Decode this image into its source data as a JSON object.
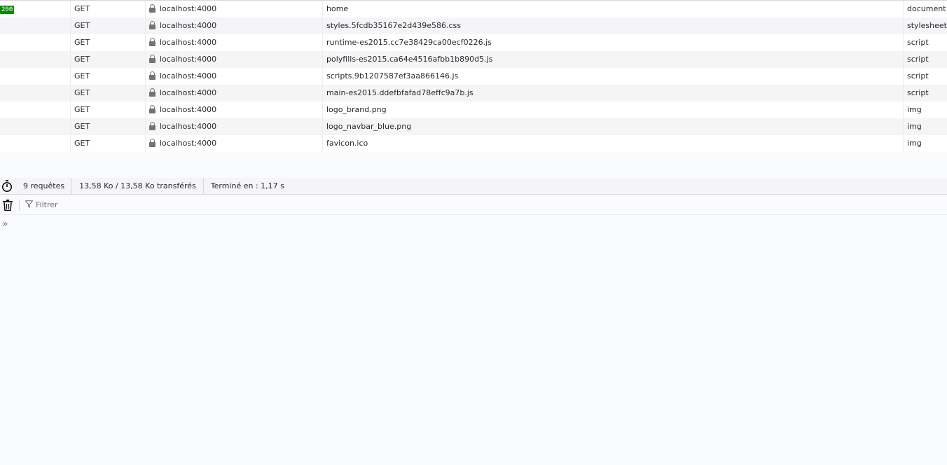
{
  "requests": [
    {
      "status": "200",
      "method": "GET",
      "domain": "localhost:4000",
      "file": "home",
      "type": "document"
    },
    {
      "status": "",
      "method": "GET",
      "domain": "localhost:4000",
      "file": "styles.5fcdb35167e2d439e586.css",
      "type": "stylesheet"
    },
    {
      "status": "",
      "method": "GET",
      "domain": "localhost:4000",
      "file": "runtime-es2015.cc7e38429ca00ecf0226.js",
      "type": "script"
    },
    {
      "status": "",
      "method": "GET",
      "domain": "localhost:4000",
      "file": "polyfills-es2015.ca64e4516afbb1b890d5.js",
      "type": "script"
    },
    {
      "status": "",
      "method": "GET",
      "domain": "localhost:4000",
      "file": "scripts.9b1207587ef3aa866146.js",
      "type": "script"
    },
    {
      "status": "",
      "method": "GET",
      "domain": "localhost:4000",
      "file": "main-es2015.ddefbfafad78effc9a7b.js",
      "type": "script"
    },
    {
      "status": "",
      "method": "GET",
      "domain": "localhost:4000",
      "file": "logo_brand.png",
      "type": "img"
    },
    {
      "status": "",
      "method": "GET",
      "domain": "localhost:4000",
      "file": "logo_navbar_blue.png",
      "type": "img"
    },
    {
      "status": "",
      "method": "GET",
      "domain": "localhost:4000",
      "file": "favicon.ico",
      "type": "img"
    }
  ],
  "status_bar": {
    "icon": "stopwatch-icon",
    "requests": "9 requêtes",
    "transferred": "13,58 Ko / 13,58 Ko transférés",
    "finished": "Terminé en : 1,17 s"
  },
  "console": {
    "clear_icon": "trash-icon",
    "filter_icon": "funnel-icon",
    "filter_placeholder": "Filtrer",
    "prompt": "»"
  },
  "colors": {
    "status_ok": "#058b00",
    "lock": "#737373"
  }
}
